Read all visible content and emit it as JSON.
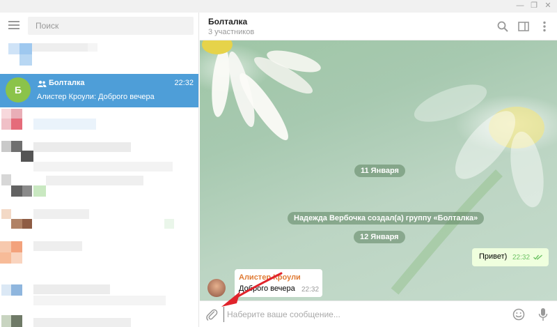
{
  "window": {
    "minimize": "—",
    "maximize": "❐",
    "close": "✕"
  },
  "sidebar": {
    "search_placeholder": "Поиск",
    "active_chat": {
      "avatar_letter": "Б",
      "name": "Болталка",
      "time": "22:32",
      "last_message": "Алистер Кроули: Доброго вечера"
    }
  },
  "conversation": {
    "title": "Болталка",
    "subtitle": "3 участников",
    "service_messages": [
      "11 Января",
      "Надежда Вербочка создал(а) группу «Болталка»",
      "12 Января"
    ],
    "outgoing": {
      "text": "Привет)",
      "time": "22:32"
    },
    "incoming": {
      "author": "Алистер Кроули",
      "text": "Доброго вечера",
      "time": "22:32"
    }
  },
  "composer": {
    "placeholder": "Наберите ваше сообщение..."
  },
  "colors": {
    "accent": "#4e9ed8",
    "avatar": "#8bc34a",
    "author": "#e07b35",
    "read_check": "#6cc264"
  },
  "icons": [
    "menu-icon",
    "group-icon",
    "search-icon",
    "sidebar-toggle-icon",
    "more-icon",
    "attach-icon",
    "emoji-icon",
    "mic-icon",
    "double-check-icon"
  ]
}
